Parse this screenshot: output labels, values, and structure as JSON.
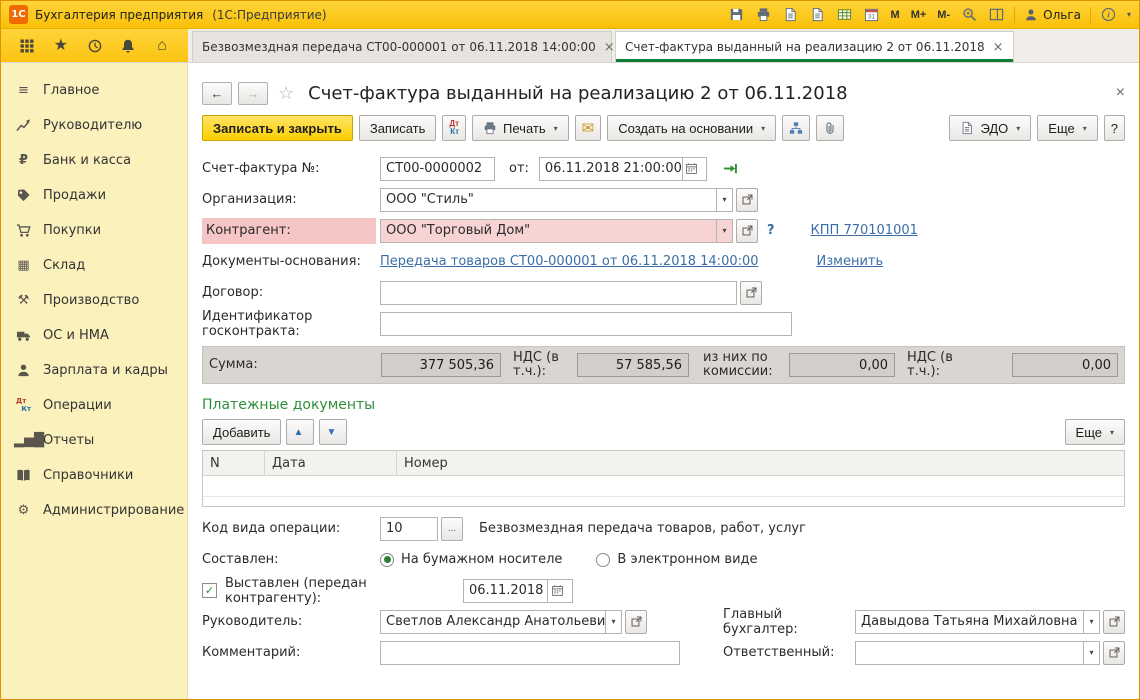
{
  "glyphs": {
    "dd": "▾",
    "back": "←",
    "forward": "→",
    "close": "×",
    "star": "★",
    "star_outline": "☆",
    "home": "⌂",
    "menu_lines": "≡",
    "ruble": "₽",
    "grid": "▦",
    "hammer": "⚒",
    "gear": "⚙",
    "envelope": "✉",
    "bars": "▂▅█",
    "up": "▲",
    "down": "▼",
    "check": "✓",
    "ellipsis": "...",
    "help": "?"
  },
  "titlebar": {
    "logo": "1С",
    "app_title": "Бухгалтерия предприятия",
    "app_edition": "(1С:Предприятие)",
    "memory": [
      "M",
      "M+",
      "M-"
    ],
    "user": "Ольга"
  },
  "tabs": [
    {
      "label": "Безвозмездная передача СТ00-000001 от 06.11.2018 14:00:00"
    },
    {
      "label": "Счет-фактура выданный на реализацию 2 от 06.11.2018"
    }
  ],
  "sidebar": {
    "items": [
      {
        "label": "Главное"
      },
      {
        "label": "Руководителю"
      },
      {
        "label": "Банк и касса"
      },
      {
        "label": "Продажи"
      },
      {
        "label": "Покупки"
      },
      {
        "label": "Склад"
      },
      {
        "label": "Производство"
      },
      {
        "label": "ОС и НМА"
      },
      {
        "label": "Зарплата и кадры"
      },
      {
        "label": "Операции"
      },
      {
        "label": "Отчеты"
      },
      {
        "label": "Справочники"
      },
      {
        "label": "Администрирование"
      }
    ]
  },
  "doc": {
    "title": "Счет-фактура выданный на реализацию 2 от 06.11.2018",
    "toolbar": {
      "save_close": "Записать и закрыть",
      "save": "Записать",
      "dt": "Дт",
      "kt": "Кт",
      "print": "Печать",
      "create_on_base": "Создать на основании",
      "edo": "ЭДО",
      "more": "Еще",
      "help": "?"
    },
    "fields": {
      "number_label": "Счет-фактура №:",
      "number": "СТ00-0000002",
      "date_prefix": "от:",
      "date": "06.11.2018 21:00:00",
      "org_label": "Организация:",
      "org": "ООО \"Стиль\"",
      "counterparty_label": "Контрагент:",
      "counterparty": "ООО \"Торговый Дом\"",
      "counterparty_help": "?",
      "kpp_link": "КПП 770101001",
      "basis_label": "Документы-основания:",
      "basis_link": "Передача товаров СТ00-000001 от 06.11.2018 14:00:00",
      "change_link": "Изменить",
      "contract_label": "Договор:",
      "gov_contract_label": "Идентификатор госконтракта:",
      "gov_contract": ""
    },
    "sums": {
      "sum_label": "Сумма:",
      "sum": "377 505,36",
      "vat_label": "НДС (в т.ч.):",
      "vat": "57 585,56",
      "commission_label": "из них по комиссии:",
      "commission": "0,00",
      "vat2_label": "НДС (в т.ч.):",
      "vat2": "0,00"
    },
    "payment": {
      "title": "Платежные документы",
      "add": "Добавить",
      "more": "Еще",
      "columns": [
        "N",
        "Дата",
        "Номер"
      ]
    },
    "footer": {
      "op_code_label": "Код вида операции:",
      "op_code": "10",
      "op_desc": "Безвозмездная передача товаров, работ, услуг",
      "composed_label": "Составлен:",
      "radio_paper": "На бумажном носителе",
      "radio_electronic": "В электронном виде",
      "issued_label": "Выставлен (передан контрагенту):",
      "issued_date": "06.11.2018",
      "manager_label": "Руководитель:",
      "manager": "Светлов Александр Анатольевич",
      "chief_accountant_label": "Главный бухгалтер:",
      "chief_accountant": "Давыдова Татьяна Михайловна",
      "comment_label": "Комментарий:",
      "comment": "",
      "responsible_label": "Ответственный:",
      "responsible": ""
    }
  }
}
